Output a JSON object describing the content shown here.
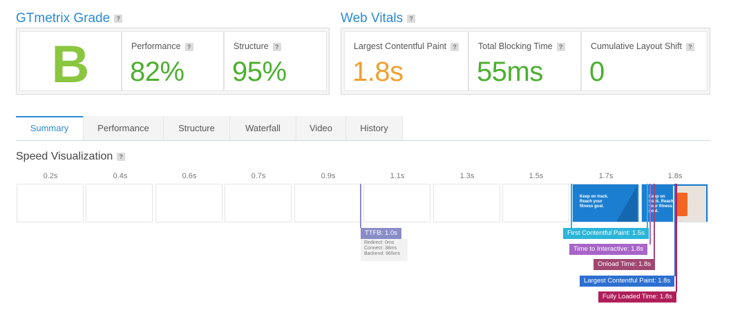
{
  "gtmetrix": {
    "title": "GTmetrix Grade",
    "help": "?",
    "grade": "B",
    "performance_label": "Performance",
    "performance_value": "82%",
    "structure_label": "Structure",
    "structure_value": "95%"
  },
  "web_vitals": {
    "title": "Web Vitals",
    "help": "?",
    "lcp_label": "Largest Contentful Paint",
    "lcp_value": "1.8s",
    "tbt_label": "Total Blocking Time",
    "tbt_value": "55ms",
    "cls_label": "Cumulative Layout Shift",
    "cls_value": "0"
  },
  "tabs": [
    "Summary",
    "Performance",
    "Structure",
    "Waterfall",
    "Video",
    "History"
  ],
  "speed": {
    "title": "Speed Visualization",
    "help": "?",
    "ticks": [
      "0.2s",
      "0.4s",
      "0.6s",
      "0.7s",
      "0.9s",
      "1.1s",
      "1.3s",
      "1.5s",
      "1.7s",
      "1.8s"
    ],
    "screenshot_text": "Keep on track. Reach your fitness goal.",
    "ttfb_label": "TTFB: 1.0s",
    "ttfb_details": [
      "Redirect: 0ms",
      "Connect: 38ms",
      "Backend: 965ms"
    ],
    "markers": {
      "fcp": "First Contentful Paint: 1.5s",
      "tti": "Time to Interactive: 1.8s",
      "onload": "Onload Time: 1.8s",
      "lcp": "Largest Contentful Paint: 1.8s",
      "fully_loaded": "Fully Loaded Time: 1.8s"
    }
  },
  "colors": {
    "accent": "#2a8ad4",
    "grade_b": "#8ac63f",
    "good": "#4caf2f",
    "warn": "#f0a030",
    "ttfb": "#8a8cc7",
    "fcp": "#2bb5d8",
    "tti": "#a864c8",
    "onload": "#a04670",
    "lcp": "#2d6fd0",
    "fully_loaded": "#b01e5a"
  }
}
